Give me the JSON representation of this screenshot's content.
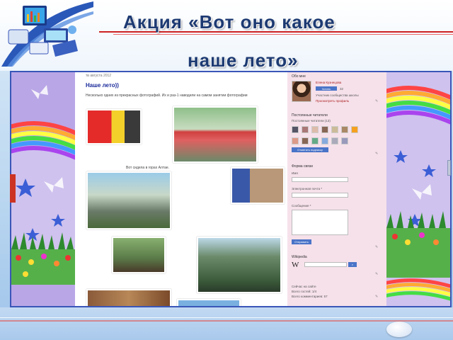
{
  "slide": {
    "title_line1": "Акция «Вот оно какое",
    "title_line2": "наше лето»"
  },
  "blog_post": {
    "date": "тв августа 2012",
    "title": "Наше лето))",
    "text": "Несколько одних из прекрасных фотографий. Их и раз-1 наводили на самом занятии фотографии",
    "caption": "Вот сидела в горах Алтае."
  },
  "sidebar": {
    "about_header": "Обо мне",
    "profile_name": "Елена Кузнецова",
    "follow_label": "Читать",
    "follow_count": "32",
    "profile_link": "Участник сообщества школы",
    "profile_link2": "Просмотреть профиль",
    "followers_header": "Постоянные читатели",
    "followers_sub": "Постоянные читатели (13)",
    "follow_button": "Отметить подписку",
    "form_header": "Форма связи",
    "name_label": "Имя",
    "email_label": "Электронная почта *",
    "message_label": "Сообщение *",
    "send_button": "Отправить",
    "wiki_header": "Wikipedia",
    "wiki_logo": "W",
    "stats_1": "Сейчас на сайте",
    "stats_2": "Всего гостей: 1/4",
    "stats_3": "Всего комментариев: 57"
  },
  "colors": {
    "title": "#1d3a72",
    "frame_border": "#3a56b8",
    "post_title": "#1a2a9a",
    "sidebar_bg": "#f6e1ea",
    "accent_red": "#cc2222"
  }
}
